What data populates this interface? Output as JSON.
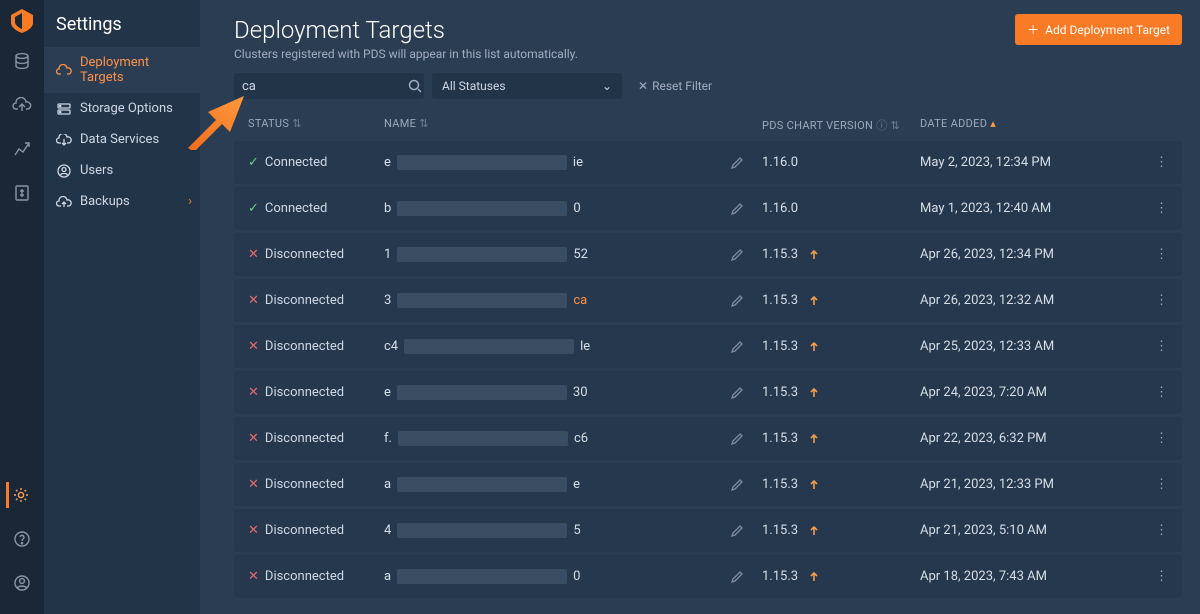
{
  "app": {
    "logo_color": "#fa7b25"
  },
  "rail": {
    "items": [
      "database",
      "cloud-up",
      "chart",
      "spreadsheet"
    ],
    "bottom": [
      "gear",
      "help",
      "user"
    ]
  },
  "nav2": {
    "title": "Settings",
    "items": [
      {
        "label": "Deployment Targets",
        "icon": "cloud",
        "active": true
      },
      {
        "label": "Storage Options",
        "icon": "storage",
        "active": false
      },
      {
        "label": "Data Services",
        "icon": "cloud-down",
        "active": false
      },
      {
        "label": "Users",
        "icon": "user-circle",
        "active": false
      },
      {
        "label": "Backups",
        "icon": "cloud-arrow",
        "active": false,
        "expandable": true
      }
    ]
  },
  "page": {
    "title": "Deployment Targets",
    "subtitle": "Clusters registered with PDS will appear in this list automatically.",
    "add_button": "Add Deployment Target",
    "search_value": "ca",
    "status_label": "All Statuses",
    "reset_label": "Reset Filter"
  },
  "columns": {
    "status": "STATUS",
    "name": "NAME",
    "version": "PDS CHART VERSION",
    "date": "DATE ADDED"
  },
  "rows": [
    {
      "status": "Connected",
      "name_prefix": "e",
      "name_suffix": "ie",
      "version": "1.16.0",
      "upgrade": false,
      "date": "May 2, 2023, 12:34 PM"
    },
    {
      "status": "Connected",
      "name_prefix": "b",
      "name_suffix": "0",
      "version": "1.16.0",
      "upgrade": false,
      "date": "May 1, 2023, 12:40 AM"
    },
    {
      "status": "Disconnected",
      "name_prefix": "1",
      "name_suffix": "52",
      "version": "1.15.3",
      "upgrade": true,
      "date": "Apr 26, 2023, 12:34 PM"
    },
    {
      "status": "Disconnected",
      "name_prefix": "3",
      "name_suffix": "ca",
      "version": "1.15.3",
      "upgrade": true,
      "date": "Apr 26, 2023, 12:32 AM",
      "suffix_orange": true
    },
    {
      "status": "Disconnected",
      "name_prefix": "c4",
      "name_suffix": "le",
      "version": "1.15.3",
      "upgrade": true,
      "date": "Apr 25, 2023, 12:33 AM"
    },
    {
      "status": "Disconnected",
      "name_prefix": "e",
      "name_suffix": "30",
      "version": "1.15.3",
      "upgrade": true,
      "date": "Apr 24, 2023, 7:20 AM"
    },
    {
      "status": "Disconnected",
      "name_prefix": "f.",
      "name_suffix": "c6",
      "version": "1.15.3",
      "upgrade": true,
      "date": "Apr 22, 2023, 6:32 PM"
    },
    {
      "status": "Disconnected",
      "name_prefix": "a",
      "name_suffix": "e",
      "version": "1.15.3",
      "upgrade": true,
      "date": "Apr 21, 2023, 12:33 PM"
    },
    {
      "status": "Disconnected",
      "name_prefix": "4",
      "name_suffix": "5",
      "version": "1.15.3",
      "upgrade": true,
      "date": "Apr 21, 2023, 5:10 AM"
    },
    {
      "status": "Disconnected",
      "name_prefix": "a",
      "name_suffix": "0",
      "version": "1.15.3",
      "upgrade": true,
      "date": "Apr 18, 2023, 7:43 AM"
    }
  ]
}
